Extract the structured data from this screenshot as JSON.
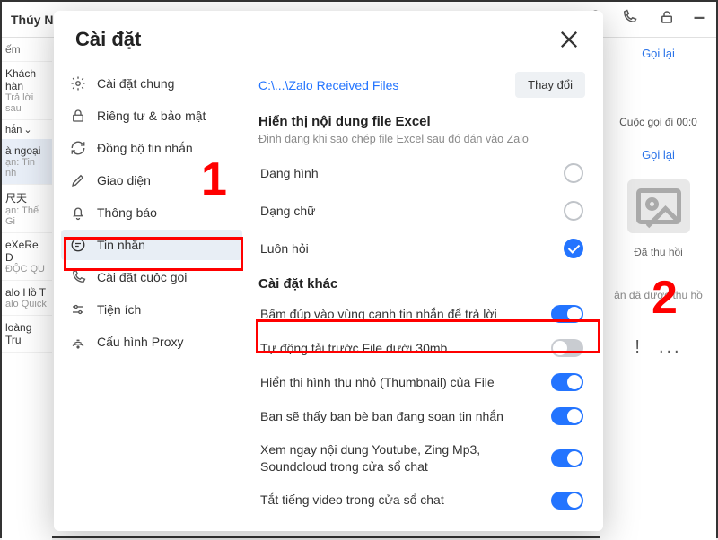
{
  "backdrop": {
    "header_title": "Thúy Ng",
    "search_ph": "ếm",
    "call_pill": "Gọi lại",
    "call_text": "Cuộc gọi đi 00:0",
    "call_again": "Gọi lại",
    "img_recall": "Đã thu hồi",
    "recalled_msg": "ản đã được thu hồ",
    "exclaim": "!",
    "dots": "...",
    "chats": [
      {
        "cn": "Khách hàn",
        "sub": "Trả lời sau"
      },
      {
        "cn": "à ngoại",
        "sub": "ạn: Tin nh"
      },
      {
        "cn": "尺天",
        "sub": "ạn: Thế Gi"
      },
      {
        "cn": "eXeRe Đ",
        "sub": "ĐỘC QU"
      },
      {
        "cn": "alo Hồ T",
        "sub": "alo Quick"
      },
      {
        "cn": "loàng Tru",
        "sub": ""
      }
    ],
    "pin_label": "hắn"
  },
  "modal": {
    "title": "Cài đặt"
  },
  "sidebar": {
    "items": [
      {
        "label": "Cài đặt chung"
      },
      {
        "label": "Riêng tư & bảo mật"
      },
      {
        "label": "Đồng bộ tin nhắn"
      },
      {
        "label": "Giao diện"
      },
      {
        "label": "Thông báo"
      },
      {
        "label": "Tin nhắn"
      },
      {
        "label": "Cài đặt cuộc gọi"
      },
      {
        "label": "Tiện ích"
      },
      {
        "label": "Cấu hình Proxy"
      }
    ]
  },
  "content": {
    "path": "C:\\...\\Zalo Received Files",
    "change_btn": "Thay đổi",
    "excel_title": "Hiển thị nội dung file Excel",
    "excel_desc": "Định dạng khi sao chép file Excel sau đó dán vào Zalo",
    "radios": [
      {
        "label": "Dạng hình",
        "checked": false
      },
      {
        "label": "Dạng chữ",
        "checked": false
      },
      {
        "label": "Luôn hỏi",
        "checked": true
      }
    ],
    "other_title": "Cài đặt khác",
    "toggles": [
      {
        "label": "Bấm đúp vào vùng cạnh tin nhắn để trả lời",
        "on": true
      },
      {
        "label": "Tự động tải trước File dưới 30mb",
        "on": false
      },
      {
        "label": "Hiển thị hình thu nhỏ (Thumbnail) của File",
        "on": true
      },
      {
        "label": "Bạn sẽ thấy bạn bè bạn đang soạn tin nhắn",
        "on": true
      },
      {
        "label": "Xem ngay nội dung Youtube, Zing Mp3, Soundcloud trong cửa sổ chat",
        "on": true
      },
      {
        "label": "Tắt tiếng video trong cửa sổ chat",
        "on": true
      }
    ]
  },
  "anno": {
    "one": "1",
    "two": "2"
  }
}
